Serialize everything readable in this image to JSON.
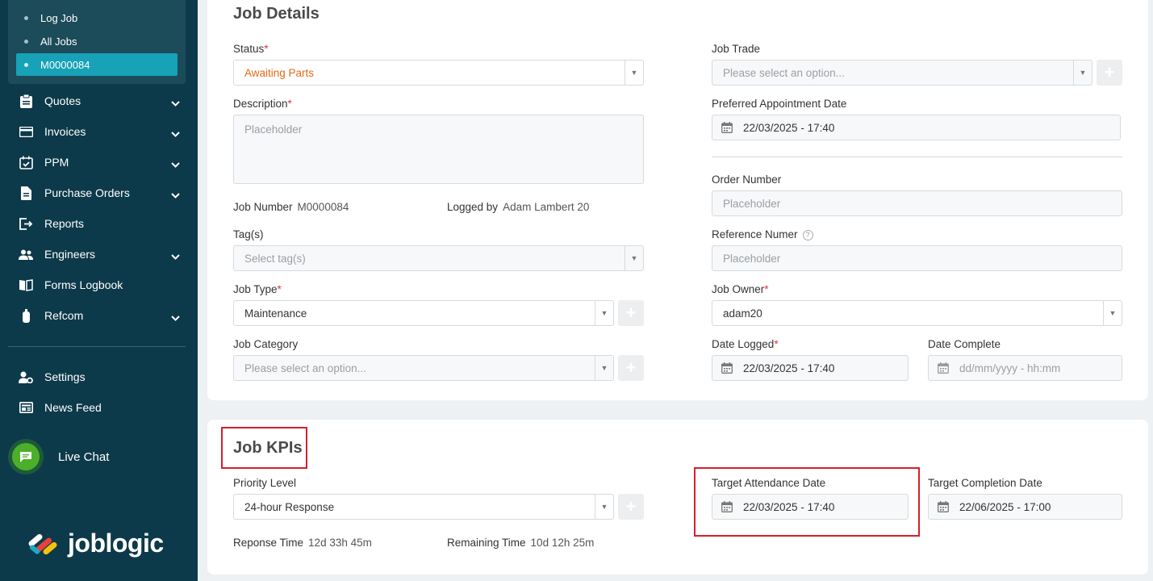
{
  "sidebar": {
    "submenu": [
      {
        "label": "Log Job",
        "active": false
      },
      {
        "label": "All Jobs",
        "active": false
      },
      {
        "label": "M0000084",
        "active": true
      }
    ],
    "items": [
      {
        "label": "Quotes",
        "icon": "clipboard-icon",
        "has_chevron": true
      },
      {
        "label": "Invoices",
        "icon": "card-icon",
        "has_chevron": true
      },
      {
        "label": "PPM",
        "icon": "calendar-check-icon",
        "has_chevron": true
      },
      {
        "label": "Purchase Orders",
        "icon": "document-icon",
        "has_chevron": true
      },
      {
        "label": "Reports",
        "icon": "export-icon",
        "has_chevron": false
      },
      {
        "label": "Engineers",
        "icon": "people-icon",
        "has_chevron": true
      },
      {
        "label": "Forms Logbook",
        "icon": "book-icon",
        "has_chevron": false
      },
      {
        "label": "Refcom",
        "icon": "cylinder-icon",
        "has_chevron": true
      }
    ],
    "bottom_items": [
      {
        "label": "Settings",
        "icon": "user-settings-icon"
      },
      {
        "label": "News Feed",
        "icon": "newspaper-icon"
      }
    ],
    "live_chat": "Live Chat",
    "logo_text": "joblogic"
  },
  "job_details": {
    "title": "Job Details",
    "status": {
      "label": "Status",
      "value": "Awaiting Parts"
    },
    "description": {
      "label": "Description",
      "placeholder": "Placeholder"
    },
    "job_number": {
      "label": "Job Number",
      "value": "M0000084"
    },
    "logged_by": {
      "label": "Logged by",
      "value": "Adam Lambert 20"
    },
    "tags": {
      "label": "Tag(s)",
      "placeholder": "Select tag(s)"
    },
    "job_type": {
      "label": "Job Type",
      "value": "Maintenance"
    },
    "job_category": {
      "label": "Job Category",
      "placeholder": "Please select an option..."
    },
    "job_trade": {
      "label": "Job Trade",
      "placeholder": "Please select an option..."
    },
    "preferred_appointment": {
      "label": "Preferred Appointment Date",
      "value": "22/03/2025 - 17:40"
    },
    "order_number": {
      "label": "Order Number",
      "placeholder": "Placeholder"
    },
    "reference_number": {
      "label": "Reference Numer",
      "placeholder": "Placeholder"
    },
    "job_owner": {
      "label": "Job Owner",
      "value": "adam20"
    },
    "date_logged": {
      "label": "Date Logged",
      "value": "22/03/2025 - 17:40"
    },
    "date_complete": {
      "label": "Date Complete",
      "placeholder": "dd/mm/yyyy - hh:mm"
    }
  },
  "job_kpis": {
    "title": "Job KPIs",
    "priority_level": {
      "label": "Priority Level",
      "value": "24-hour Response"
    },
    "response_time": {
      "label": "Reponse Time",
      "value": "12d 33h 45m"
    },
    "remaining_time": {
      "label": "Remaining Time",
      "value": "10d 12h 25m"
    },
    "target_attendance": {
      "label": "Target Attendance Date",
      "value": "22/03/2025 - 17:40"
    },
    "target_completion": {
      "label": "Target Completion Date",
      "value": "22/06/2025 - 17:00"
    }
  },
  "colors": {
    "sidebar_bg": "#0d3a4a",
    "active": "#17a2b8",
    "highlight": "#d61f2c",
    "required": "#d9363e",
    "status_value": "#e26a15"
  }
}
